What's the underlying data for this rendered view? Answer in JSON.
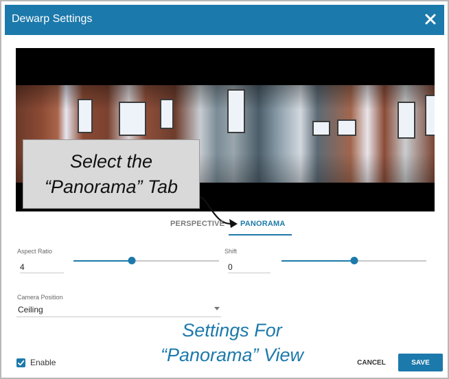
{
  "dialog": {
    "title": "Dewarp Settings"
  },
  "callout": {
    "line1": "Select the",
    "line2": "“Panorama” Tab"
  },
  "tabs": [
    {
      "label": "PERSPECTIVE",
      "active": false
    },
    {
      "label": "PANORAMA",
      "active": true
    }
  ],
  "aspect_ratio": {
    "label": "Aspect Ratio",
    "value": "4",
    "slider_fraction": 0.4
  },
  "shift": {
    "label": "Shift",
    "value": "0",
    "slider_fraction": 0.5
  },
  "camera_position": {
    "label": "Camera Position",
    "value": "Ceiling"
  },
  "note": {
    "line1": "Settings For",
    "line2": "“Panorama” View"
  },
  "enable": {
    "label": "Enable",
    "checked": true
  },
  "buttons": {
    "cancel": "CANCEL",
    "save": "SAVE"
  },
  "colors": {
    "accent": "#1c79ab",
    "header": "#1c79ab"
  },
  "icons": {
    "close": "close-icon",
    "check": "check-icon",
    "dropdown": "chevron-down-icon"
  }
}
